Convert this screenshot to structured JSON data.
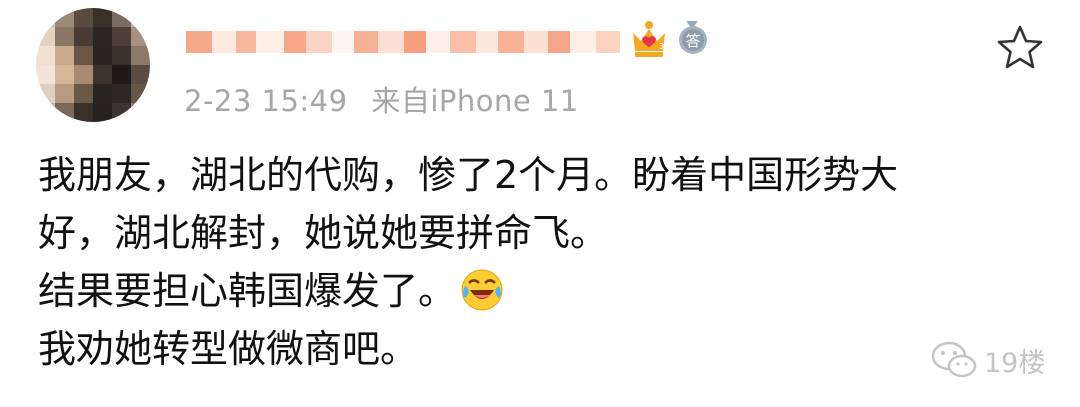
{
  "post": {
    "timestamp": "2-23 15:49",
    "source": "来自iPhone 11",
    "lines": [
      "我朋友，湖北的代购，惨了2个月。盼着中国形势大",
      "好，湖北解封，她说她要拼命飞。",
      "结果要担心韩国爆发了。",
      "我劝她转型做微商吧。"
    ],
    "emoji": "laughing-crying-emoji"
  },
  "badges": {
    "answer_text": "答"
  },
  "watermark": {
    "text": "19楼"
  },
  "icons": {
    "favorite": "star-icon",
    "crown": "crown-badge-icon",
    "answer": "answer-medal-icon",
    "wechat": "wechat-icon"
  },
  "colors": {
    "text": "#111111",
    "meta": "#a6a6a6",
    "crown": "#f5a623",
    "watermark": "#c4c4c4"
  }
}
